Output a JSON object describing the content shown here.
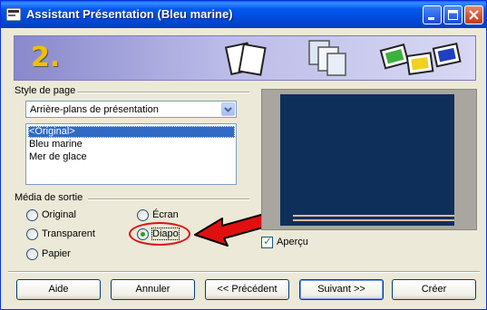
{
  "window": {
    "title": "Assistant Présentation (Bleu marine)"
  },
  "banner": {
    "step_number": "2."
  },
  "page_style": {
    "label": "Style de page",
    "combo_value": "Arrière-plans de présentation",
    "list_items": [
      "<Original>",
      "Bleu marine",
      "Mer de glace"
    ],
    "selected_index": 0
  },
  "output_media": {
    "label": "Média de sortie",
    "options": [
      "Original",
      "Écran",
      "Transparent",
      "Diapo",
      "Papier"
    ],
    "selected": "Diapo"
  },
  "preview": {
    "checkbox_label": "Aperçu",
    "checked": true
  },
  "buttons": {
    "help": "Aide",
    "cancel": "Annuler",
    "previous": "<< Précédent",
    "next": "Suivant >>",
    "create": "Créer"
  },
  "colors": {
    "annotation": "#e01010",
    "slide_background": "#0f2f5b",
    "title_bar": "#0054e3"
  }
}
